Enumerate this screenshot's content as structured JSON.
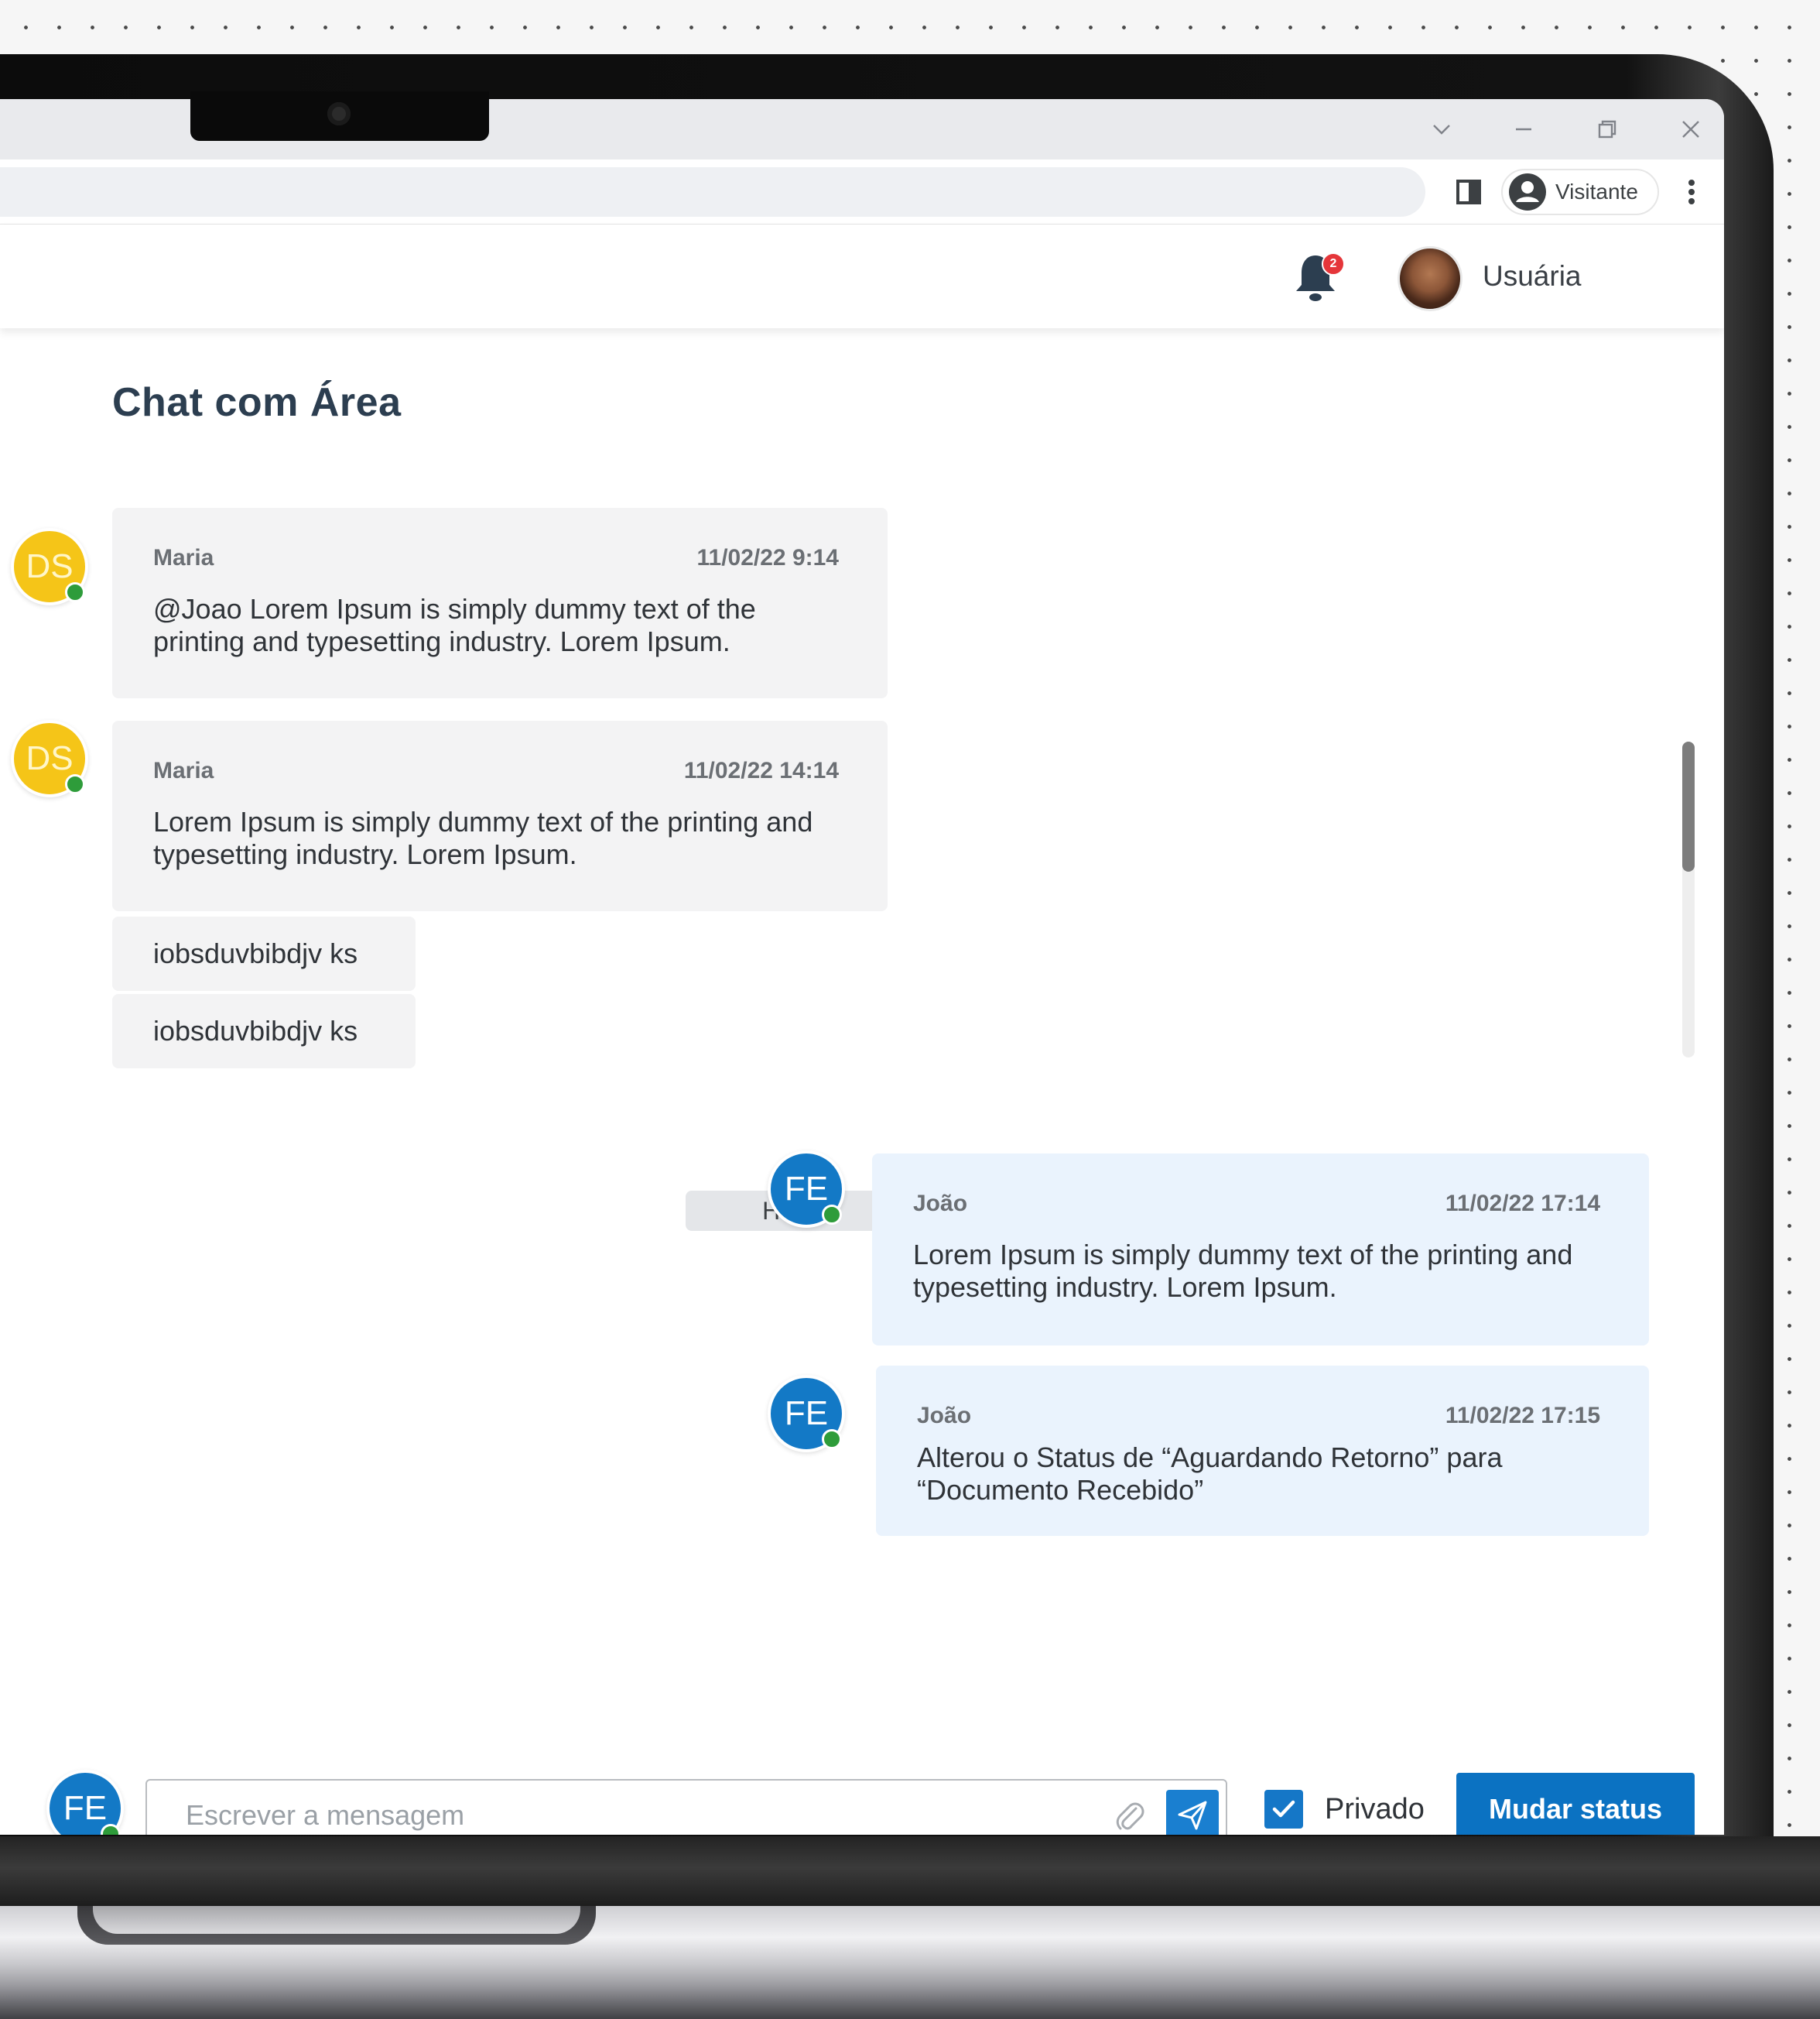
{
  "colors": {
    "accent": "#0b72c2",
    "online_status": "#2e9c3a",
    "badge": "#e5363a",
    "incoming_bubble": "#f3f3f4",
    "outgoing_bubble": "#eaf3fd"
  },
  "browser": {
    "profile_label": "Visitante"
  },
  "header": {
    "notification_count": "2",
    "user_name": "Usuária"
  },
  "page": {
    "title": "Chat com Área"
  },
  "messages": [
    {
      "avatar_initials": "DS",
      "author": "Maria",
      "timestamp": "11/02/22 9:14",
      "text": "@Joao Lorem Ipsum is simply dummy text of the printing and typesetting industry. Lorem Ipsum."
    },
    {
      "avatar_initials": "DS",
      "author": "Maria",
      "timestamp": "11/02/22 14:14",
      "text": "Lorem Ipsum is simply dummy text of the printing and typesetting industry. Lorem Ipsum."
    },
    {
      "text": "iobsduvbibdjv ks"
    },
    {
      "text": "iobsduvbibdjv ks"
    },
    {
      "avatar_initials": "FE",
      "author": "João",
      "timestamp": "11/02/22 17:14",
      "text": "Lorem Ipsum is simply dummy text of the printing and typesetting industry. Lorem Ipsum."
    },
    {
      "avatar_initials": "FE",
      "author": "João",
      "timestamp": "11/02/22 17:15",
      "text": "Alterou o Status de “Aguardando Retorno” para “Documento Recebido”"
    }
  ],
  "day_separator": "Hoje",
  "composer": {
    "avatar_initials": "FE",
    "placeholder": "Escrever a mensagem",
    "value": "",
    "private_checked": true,
    "private_label": "Privado",
    "status_button_label": "Mudar status"
  },
  "icons": {
    "window_controls": [
      "chevron-down-icon",
      "minimize-icon",
      "restore-icon",
      "close-icon"
    ],
    "toolbar": [
      "side-panel-icon",
      "profile-icon",
      "more-vert-icon"
    ],
    "header": [
      "bell-icon"
    ],
    "composer": [
      "paperclip-icon",
      "send-icon",
      "checkmark-icon"
    ]
  }
}
